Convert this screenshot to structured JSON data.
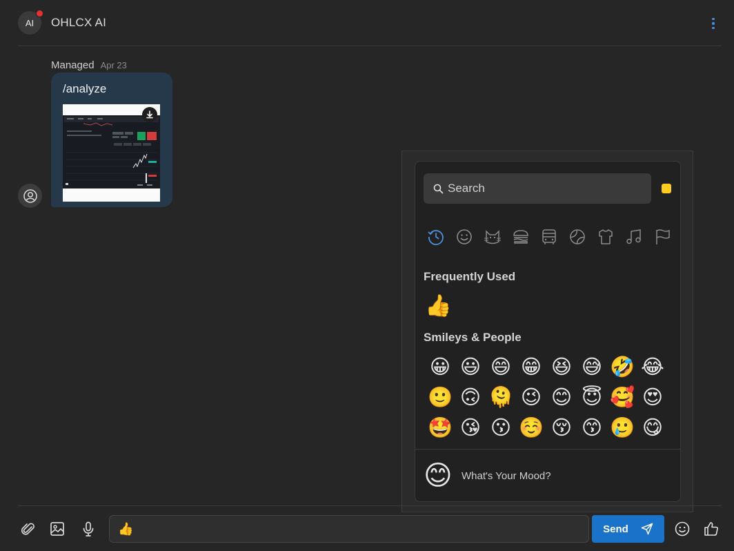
{
  "header": {
    "avatar_text": "AI",
    "title": "OHLCX AI",
    "more_icon": "kebab-vertical-icon"
  },
  "message": {
    "sender": "Managed",
    "date": "Apr 23",
    "text": "/analyze",
    "attachment_icon": "download-icon"
  },
  "emoji_picker": {
    "search_placeholder": "Search",
    "skin_tone_color": "#ffcc1f",
    "categories": [
      "recent-icon",
      "smiley-icon",
      "animal-icon",
      "food-icon",
      "travel-icon",
      "activity-icon",
      "objects-icon",
      "symbols-icon",
      "flags-icon"
    ],
    "active_category_color": "#4a8fe0",
    "frequently_used_title": "Frequently Used",
    "frequently_used": [
      "👍"
    ],
    "smileys_title": "Smileys & People",
    "smileys": [
      "😀",
      "😃",
      "😄",
      "😁",
      "😆",
      "😅",
      "🤣",
      "😂",
      "🙂",
      "🙃",
      "🫠",
      "😉",
      "😊",
      "😇",
      "🥰",
      "😍",
      "🤩",
      "😘",
      "😗",
      "☺️",
      "😚",
      "😙",
      "🥲",
      "😋"
    ],
    "mood_emoji": "😊",
    "mood_text": "What's Your Mood?"
  },
  "composer": {
    "value": "👍",
    "send_label": "Send"
  },
  "colors": {
    "accent": "#1a73c8",
    "notification": "#e5322e"
  }
}
